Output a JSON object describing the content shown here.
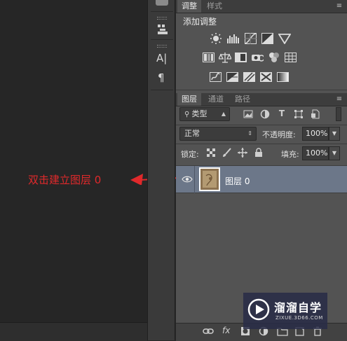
{
  "annotation": {
    "text": "双击建立图层 0",
    "color": "#e0292b"
  },
  "adjustments_panel": {
    "tabs": [
      "调整",
      "样式"
    ],
    "active_tab": 0,
    "title": "添加调整",
    "row1_icons": [
      "brightness-contrast-icon",
      "levels-icon",
      "curves-icon",
      "exposure-icon",
      "vibrance-icon"
    ],
    "row2_icons": [
      "hue-saturation-icon",
      "color-balance-icon",
      "black-white-icon",
      "photo-filter-icon",
      "channel-mixer-icon",
      "color-lookup-icon"
    ],
    "row3_icons": [
      "invert-icon",
      "posterize-icon",
      "threshold-icon",
      "selective-color-icon",
      "gradient-map-icon"
    ]
  },
  "layers_panel": {
    "tabs": [
      "图层",
      "通道",
      "路径"
    ],
    "active_tab": 0,
    "filter_kind": "类型",
    "blend_mode": "正常",
    "opacity_label": "不透明度:",
    "opacity_value": "100%",
    "lock_label": "锁定:",
    "fill_label": "填充:",
    "fill_value": "100%",
    "layers": [
      {
        "name": "图层 0",
        "visible": true,
        "selected": true
      }
    ],
    "footer_icons": [
      "link-icon",
      "fx-icon",
      "mask-icon",
      "adjustment-icon",
      "group-icon",
      "new-layer-icon",
      "trash-icon"
    ],
    "footer_fx_label": "fx"
  },
  "watermark": {
    "name": "溜溜自学",
    "url": "ZIXUE.3D66.COM"
  },
  "colors": {
    "selected_row": "#6c7789",
    "panel": "#535353",
    "accent_red": "#e0292b"
  }
}
